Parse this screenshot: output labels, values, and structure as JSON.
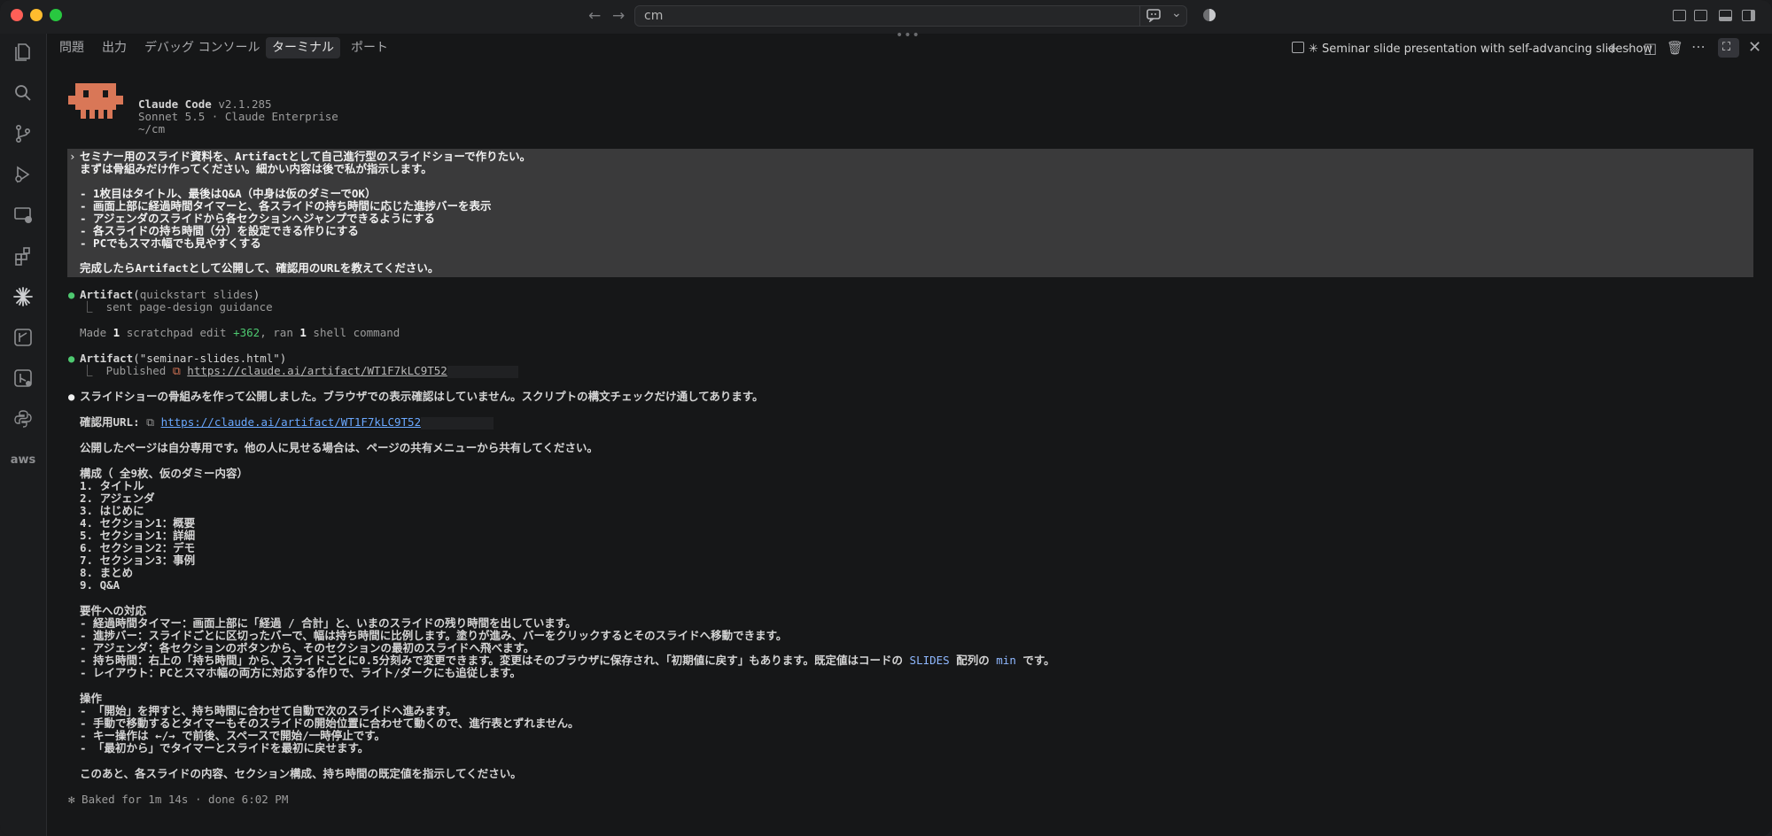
{
  "titlebar": {
    "command_input": "cm"
  },
  "panel": {
    "tabs": [
      "問題",
      "出力",
      "デバッグ コンソール",
      "ターミナル",
      "ポート"
    ],
    "active_tab": "ターミナル",
    "terminal_title": "✳ Seminar slide presentation with self-advancing slideshow"
  },
  "header": {
    "app_name": "Claude Code",
    "version": "v2.1.285",
    "model_line": "Sonnet 5.5 · Claude Enterprise",
    "cwd": "~/cm"
  },
  "prompt": {
    "arrow": "›",
    "lines": [
      "セミナー用のスライド資料を、Artifactとして自己進行型のスライドショーで作りたい。",
      "まずは骨組みだけ作ってください。細かい内容は後で私が指示します。",
      "",
      "- 1枚目はタイトル、最後はQ&A（中身は仮のダミーでOK）",
      "- 画面上部に経過時間タイマーと、各スライドの持ち時間に応じた進捗バーを表示",
      "- アジェンダのスライドから各セクションへジャンプできるようにする",
      "- 各スライドの持ち時間（分）を設定できる作りにする",
      "- PCでもスマホ幅でも見やすくする",
      "",
      "完成したらArtifactとして公開して、確認用のURLを教えてください。"
    ]
  },
  "tool1": {
    "name": "Artifact",
    "arg": "quickstart slides",
    "result": "sent page-design guidance"
  },
  "edit_summary": {
    "prefix": "Made ",
    "count1": "1",
    "mid1": " scratchpad edit ",
    "plus": "+362",
    "mid2": ", ran ",
    "count2": "1",
    "suffix": " shell command"
  },
  "tool2": {
    "name": "Artifact",
    "arg": "\"seminar-slides.html\"",
    "result_label": "Published",
    "url": "https://claude.ai/artifact/WT1F7kLC9T52"
  },
  "reply": {
    "intro": "スライドショーの骨組みを作って公開しました。ブラウザでの表示確認はしていません。スクリプトの構文チェックだけ通してあります。",
    "url_label": "確認用URL: ",
    "url": "https://claude.ai/artifact/WT1F7kLC9T52",
    "note": "公開したページは自分専用です。他の人に見せる場合は、ページの共有メニューから共有してください。",
    "structure_title": "構成（ 全9枚、仮のダミー内容）",
    "structure": [
      "1. タイトル",
      "2. アジェンダ",
      "3. はじめに",
      "4. セクション1：概要",
      "5. セクション1：詳細",
      "6. セクション2：デモ",
      "7. セクション3：事例",
      "8. まとめ",
      "9. Q&A"
    ],
    "req_title": "要件への対応",
    "req": [
      "- 経過時間タイマー：画面上部に「経過 / 合計」と、いまのスライドの残り時間を出しています。",
      "- 進捗バー：スライドごとに区切ったバーで、幅は持ち時間に比例します。塗りが進み、バーをクリックするとそのスライドへ移動できます。",
      "- アジェンダ：各セクションのボタンから、そのセクションの最初のスライドへ飛べます。",
      "- 持ち時間：右上の「持ち時間」から、スライドごとに0.5分刻みで変更できます。変更はそのブラウザに保存され、「初期値に戻す」もあります。既定値はコードの ",
      "- レイアウト：PCとスマホ幅の両方に対応する作りで、ライト/ダークにも追従します。"
    ],
    "req_code1": "SLIDES",
    "req_code_mid": " 配列の ",
    "req_code2": "min",
    "req_code_end": " です。",
    "ops_title": "操作",
    "ops": [
      "- 「開始」を押すと、持ち時間に合わせて自動で次のスライドへ進みます。",
      "- 手動で移動するとタイマーもそのスライドの開始位置に合わせて動くので、進行表とずれません。",
      "- キー操作は ←/→ で前後、スペースで開始/一時停止です。",
      "- 「最初から」でタイマーとスライドを最初に戻せます。"
    ],
    "closing": "このあと、各スライドの内容、セクション構成、持ち時間の既定値を指示してください。"
  },
  "footer": {
    "status": "✻ Baked for 1m 14s · done 6:02 PM"
  },
  "colors": {
    "accent_green": "#4ec970",
    "link_blue": "#6aa8ff",
    "mascot": "#d97757",
    "prompt_bg": "#3a3a3b"
  }
}
